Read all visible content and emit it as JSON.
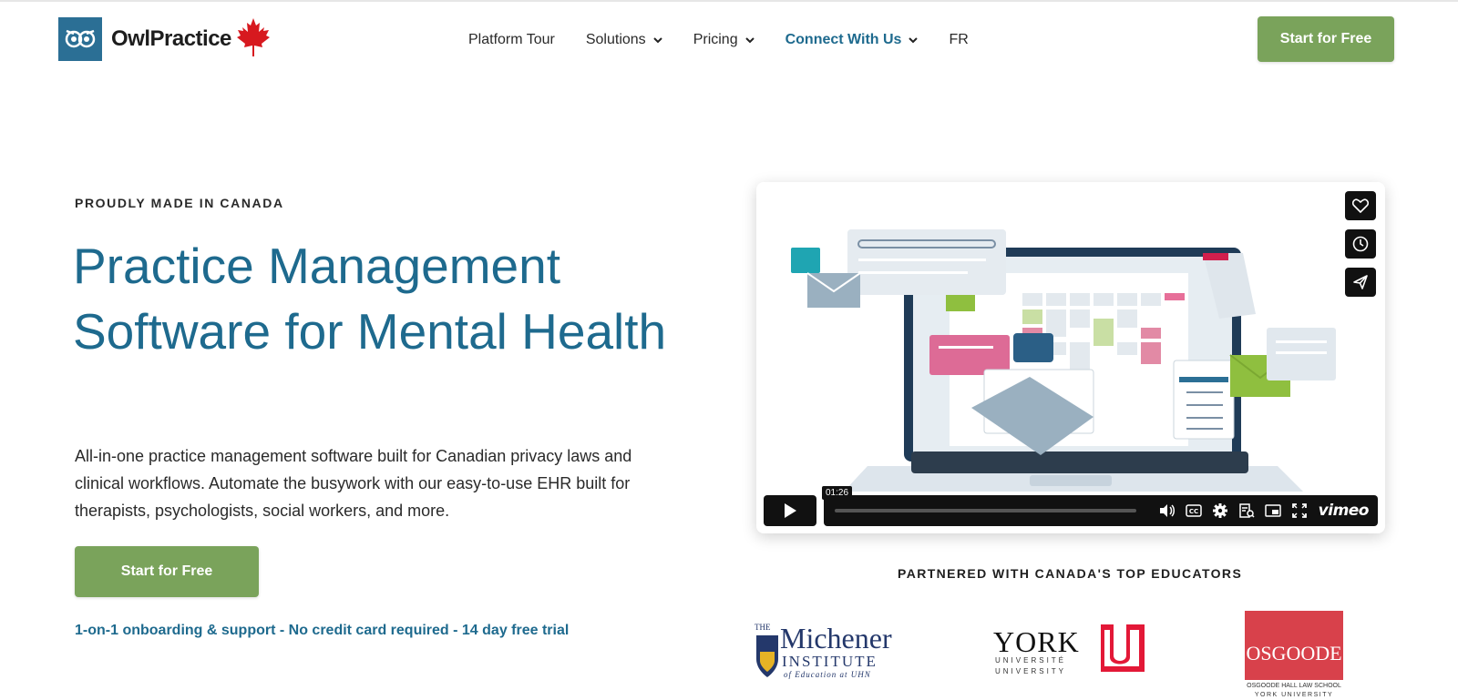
{
  "header": {
    "brand": "OwlPractice",
    "nav": [
      {
        "label": "Platform Tour",
        "dropdown": false
      },
      {
        "label": "Solutions",
        "dropdown": true
      },
      {
        "label": "Pricing",
        "dropdown": true
      },
      {
        "label": "Connect With Us",
        "dropdown": true
      },
      {
        "label": "FR",
        "dropdown": false
      }
    ],
    "cta": "Start for Free"
  },
  "hero": {
    "kicker": "PROUDLY MADE IN CANADA",
    "headline": "Practice Management Software for Mental Health",
    "description": "All-in-one practice management software built for Canadian privacy laws and clinical workflows. Automate the busywork with our easy-to-use EHR built for therapists, psychologists, social workers, and more.",
    "cta": "Start for Free",
    "subnote": "1-on-1 onboarding & support - No credit card required - 14 day free trial"
  },
  "video": {
    "timestamp": "01:26",
    "brand": "vimeo",
    "progress": 0
  },
  "partners": {
    "title": "PARTNERED WITH CANADA'S TOP EDUCATORS",
    "michener": {
      "the": "THE",
      "name": "Michener",
      "line2": "INSTITUTE",
      "line3": "of Education at UHN"
    },
    "york": {
      "name": "YORK",
      "line2": "UNIVERSITÉ",
      "line3": "UNIVERSITY"
    },
    "osgoode": {
      "name": "OSGOODE",
      "line2": "OSGOODE HALL LAW SCHOOL",
      "line3": "YORK UNIVERSITY"
    }
  },
  "colors": {
    "brand_blue": "#1e6a8e",
    "cta_green": "#7aa35b",
    "maple_red": "#d7191f",
    "york_red": "#e31837",
    "osgoode_red": "#d8414b"
  }
}
